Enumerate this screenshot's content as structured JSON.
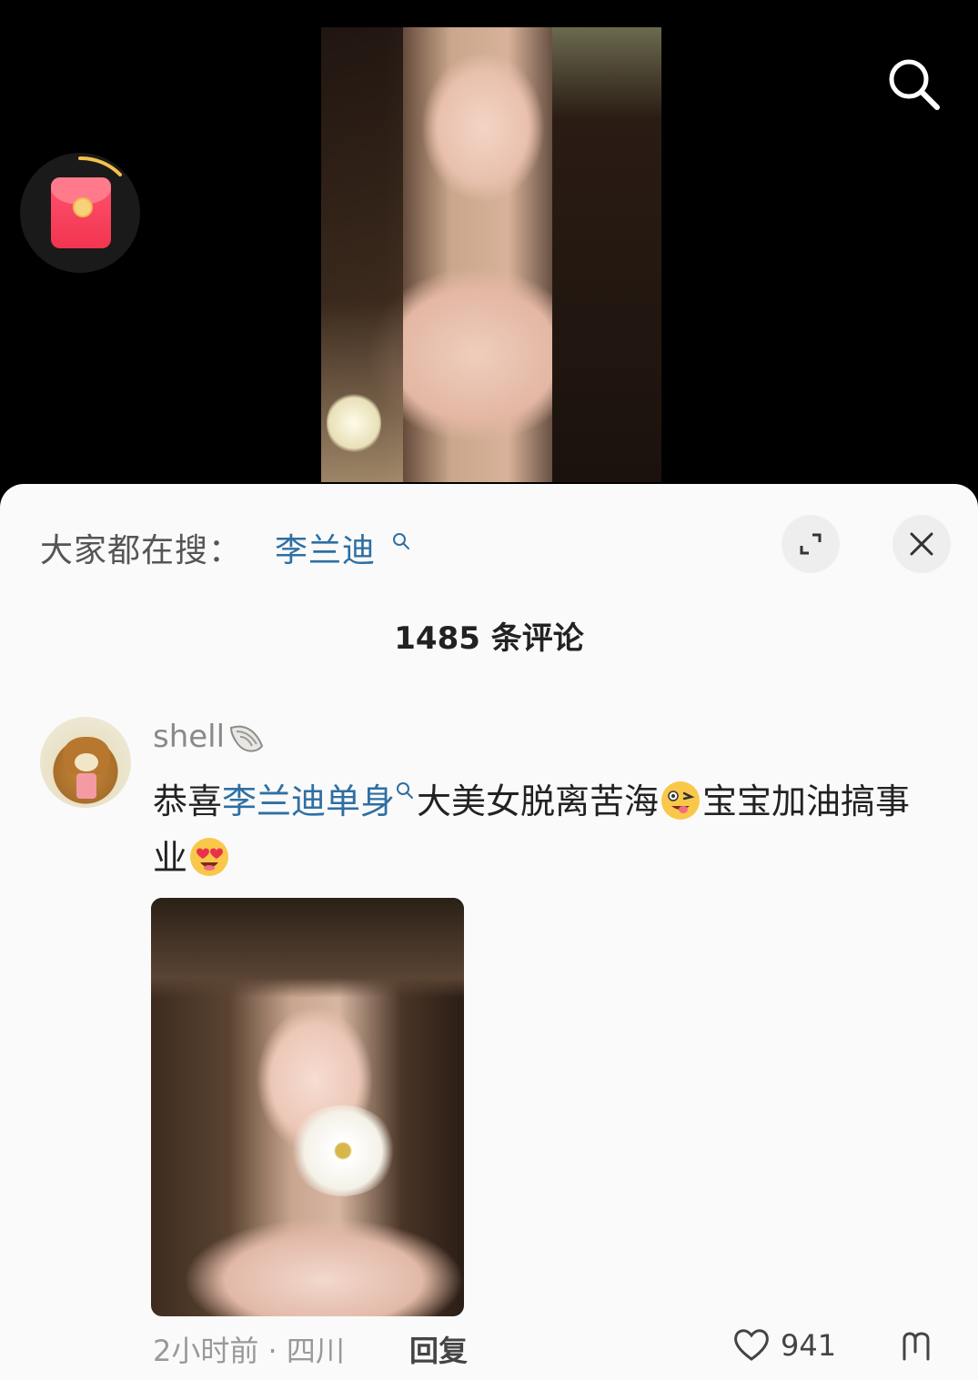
{
  "hot_search": {
    "label": "大家都在搜：",
    "term": "李兰迪"
  },
  "comments_header": {
    "count_text": "1485 条评论"
  },
  "comment": {
    "username": "shell",
    "text_prefix": "恭喜",
    "link_text": "李兰迪单身",
    "text_mid": "大美女脱离苦海",
    "text_after_emoji": "宝宝加油搞事业",
    "time": "2小时前",
    "separator": " · ",
    "location": "四川",
    "reply_label": "回复",
    "like_count": "941"
  },
  "icons": {
    "search": "search-icon",
    "red_packet": "red-packet-icon",
    "expand": "expand-icon",
    "close": "close-icon",
    "heart": "heart-icon",
    "dislike": "dislike-icon"
  },
  "colors": {
    "link": "#2e6fa3",
    "sheet_bg": "#fafafa",
    "red_packet": "#f2344f"
  }
}
